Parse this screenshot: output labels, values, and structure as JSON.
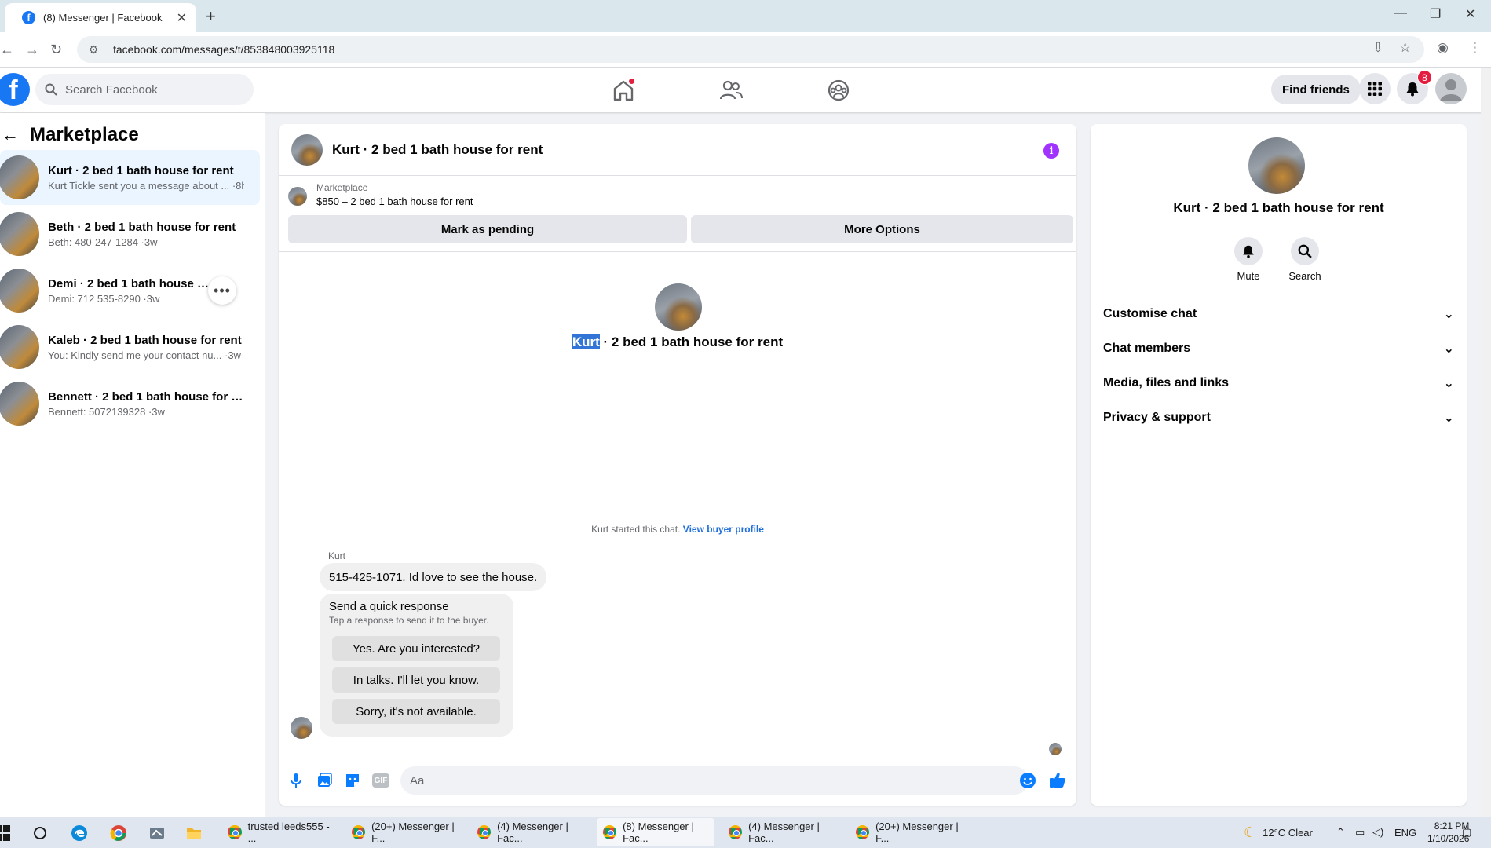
{
  "browser": {
    "tab_title": "(8) Messenger | Facebook",
    "url": "facebook.com/messages/t/853848003925118"
  },
  "header": {
    "search_placeholder": "Search Facebook",
    "find_friends": "Find friends",
    "notification_count": "8"
  },
  "sidebar": {
    "title": "Marketplace",
    "conversations": [
      {
        "name": "Kurt · 2 bed 1 bath house for rent",
        "snippet": "Kurt Tickle sent you a message about ... ·8h"
      },
      {
        "name": "Beth · 2 bed 1 bath house for rent",
        "snippet": "Beth: 480-247-1284 ·3w"
      },
      {
        "name": "Demi · 2 bed 1 bath house for r",
        "snippet": "Demi: 712 535-8290 ·3w"
      },
      {
        "name": "Kaleb · 2 bed 1 bath house for rent",
        "snippet": "You: Kindly send me your contact nu...  ·3w"
      },
      {
        "name": "Bennett · 2 bed 1 bath house for re...",
        "snippet": "Bennett: 5072139328 ·3w"
      }
    ]
  },
  "chat": {
    "title": "Kurt · 2 bed 1 bath house for rent",
    "listing_label": "Marketplace",
    "listing_price": "$850 – 2 bed 1 bath house for rent",
    "mark_pending": "Mark as pending",
    "more_options": "More Options",
    "center_name_highlight": "Kurt",
    "center_name_rest": " · 2 bed 1 bath house for rent",
    "started_text": "Kurt started this chat. ",
    "view_buyer": "View buyer profile",
    "sender": "Kurt",
    "message": "515-425-1071. Id love to see the house.",
    "quick_title": "Send a quick response",
    "quick_sub": "Tap a response to send it to the buyer.",
    "quick_responses": [
      "Yes. Are you interested?",
      "In talks. I'll let you know.",
      "Sorry, it's not available."
    ],
    "composer_placeholder": "Aa",
    "gif_label": "GIF"
  },
  "details": {
    "name": "Kurt · 2 bed 1 bath house for rent",
    "mute": "Mute",
    "search": "Search",
    "sections": [
      "Customise chat",
      "Chat members",
      "Media, files and links",
      "Privacy & support"
    ]
  },
  "taskbar": {
    "apps": [
      "trusted leeds555 - ...",
      "(20+) Messenger | F...",
      "(4) Messenger | Fac...",
      "(8) Messenger | Fac...",
      "(4) Messenger | Fac...",
      "(20+) Messenger | F..."
    ],
    "weather": "12°C  Clear",
    "lang": "ENG",
    "time": "8:21 PM",
    "date": "1/10/2026"
  },
  "colors": {
    "brand": "#1877f2",
    "messenger_accent": "#a033ff",
    "notification": "#e41e3f"
  }
}
